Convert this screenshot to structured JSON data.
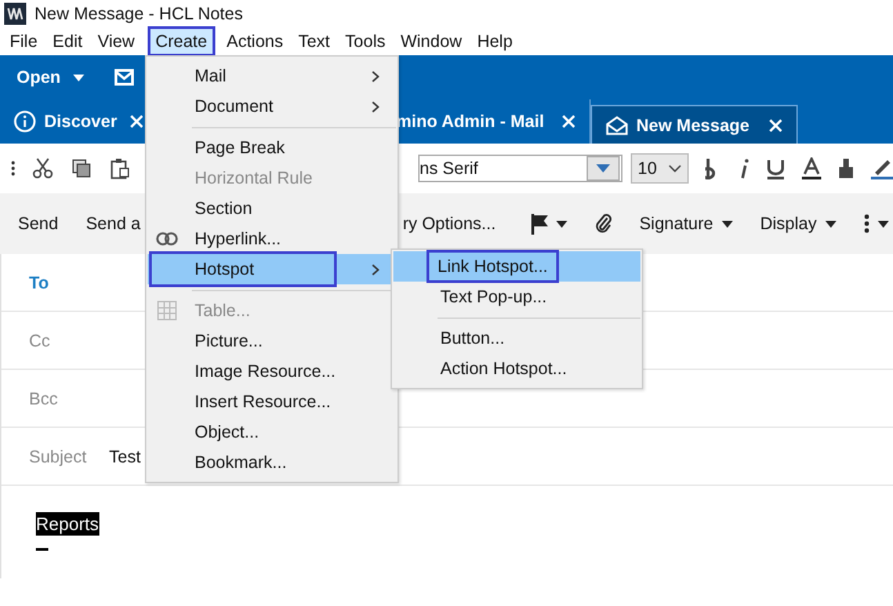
{
  "window": {
    "title": "New Message - HCL Notes"
  },
  "menu_bar": [
    {
      "label": "File",
      "selected": false
    },
    {
      "label": "Edit",
      "selected": false
    },
    {
      "label": "View",
      "selected": false
    },
    {
      "label": "Create",
      "selected": true
    },
    {
      "label": "Actions",
      "selected": false
    },
    {
      "label": "Text",
      "selected": false
    },
    {
      "label": "Tools",
      "selected": false
    },
    {
      "label": "Window",
      "selected": false
    },
    {
      "label": "Help",
      "selected": false
    }
  ],
  "toolbar": {
    "open_button": "Open"
  },
  "tabs": [
    {
      "label": "Discover",
      "selected": false,
      "kind": "info"
    },
    {
      "label": "mino Admin - Mail",
      "selected": false,
      "kind": "plain"
    },
    {
      "label": "New Message",
      "selected": true,
      "kind": "mail"
    }
  ],
  "format_bar": {
    "font": "ns Serif",
    "size": "10"
  },
  "action_bar": [
    {
      "label": "Send",
      "caret": false,
      "kind": "text"
    },
    {
      "label": "Send a",
      "caret": false,
      "kind": "text"
    },
    {
      "label": "ry Options...",
      "caret": false,
      "kind": "text"
    },
    {
      "kind": "flag",
      "caret": true
    },
    {
      "kind": "clip",
      "caret": false
    },
    {
      "label": "Signature",
      "caret": true,
      "kind": "text"
    },
    {
      "label": "Display",
      "caret": true,
      "kind": "text"
    },
    {
      "kind": "more",
      "caret": true
    }
  ],
  "fields": [
    {
      "label": "To",
      "kind": "link"
    },
    {
      "label": "Cc",
      "kind": "plain"
    },
    {
      "label": "Bcc",
      "kind": "plain"
    },
    {
      "label": "Subject",
      "kind": "plain",
      "value": "Test"
    }
  ],
  "body": {
    "text": "Reports",
    "selected": true
  },
  "create_menu": [
    {
      "kind": "item",
      "label": "Mail",
      "submenu": true,
      "disabled": false,
      "selected": false
    },
    {
      "kind": "item",
      "label": "Document",
      "submenu": true,
      "disabled": false,
      "selected": false
    },
    {
      "kind": "separator"
    },
    {
      "kind": "item",
      "label": "Page Break",
      "submenu": false,
      "disabled": false,
      "selected": false
    },
    {
      "kind": "item",
      "label": "Horizontal Rule",
      "submenu": false,
      "disabled": true,
      "selected": false
    },
    {
      "kind": "item",
      "label": "Section",
      "submenu": false,
      "disabled": false,
      "selected": false
    },
    {
      "kind": "link_item",
      "label": "Hyperlink...",
      "submenu": false,
      "disabled": false,
      "selected": false
    },
    {
      "kind": "item",
      "label": "Hotspot",
      "submenu": true,
      "disabled": false,
      "selected": true
    },
    {
      "kind": "separator"
    },
    {
      "kind": "table_item",
      "label": "Table...",
      "submenu": false,
      "disabled": true,
      "selected": false
    },
    {
      "kind": "item",
      "label": "Picture...",
      "submenu": false,
      "disabled": false,
      "selected": false
    },
    {
      "kind": "item",
      "label": "Image Resource...",
      "submenu": false,
      "disabled": false,
      "selected": false
    },
    {
      "kind": "item",
      "label": "Insert Resource...",
      "submenu": false,
      "disabled": false,
      "selected": false
    },
    {
      "kind": "item",
      "label": "Object...",
      "submenu": false,
      "disabled": false,
      "selected": false
    },
    {
      "kind": "item",
      "label": "Bookmark...",
      "submenu": false,
      "disabled": false,
      "selected": false
    }
  ],
  "hotspot_menu": [
    {
      "kind": "item",
      "label": "Link Hotspot...",
      "selected": true
    },
    {
      "kind": "item",
      "label": "Text Pop-up...",
      "selected": false
    },
    {
      "kind": "separator"
    },
    {
      "kind": "item",
      "label": "Button...",
      "selected": false
    },
    {
      "kind": "item",
      "label": "Action Hotspot...",
      "selected": false
    }
  ]
}
